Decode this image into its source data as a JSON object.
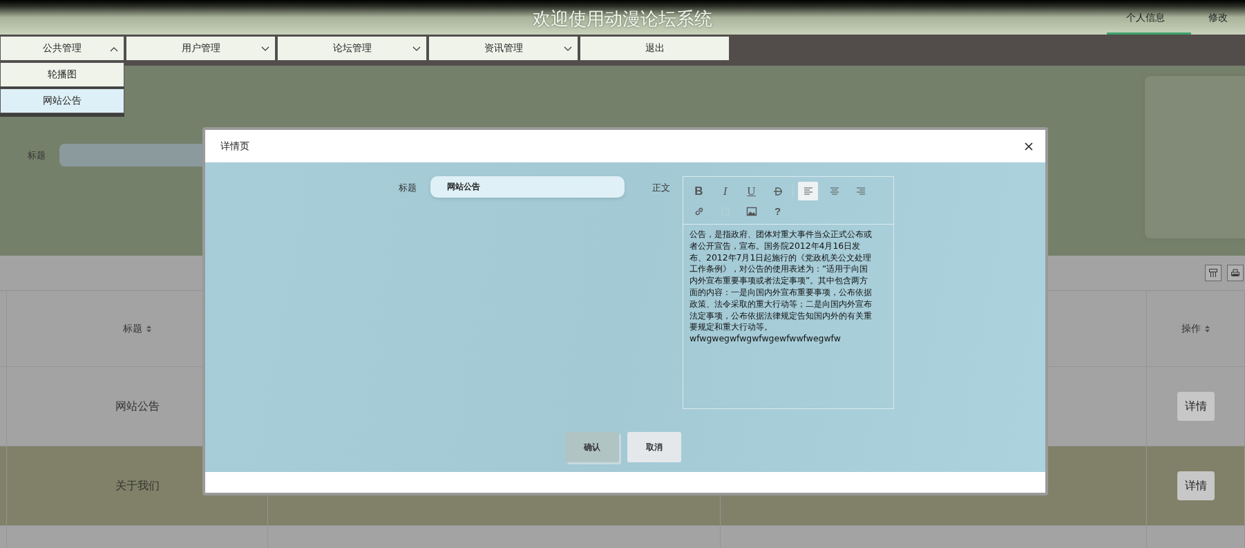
{
  "header": {
    "title": "欢迎使用动漫论坛系统",
    "user_links": [
      {
        "label": "个人信息",
        "selected": true
      },
      {
        "label": "修改",
        "selected": false
      }
    ]
  },
  "nav": [
    {
      "label": "公共管理",
      "kind": "dropdown",
      "expanded": true
    },
    {
      "label": "用户管理",
      "kind": "dropdown",
      "expanded": false
    },
    {
      "label": "论坛管理",
      "kind": "dropdown",
      "expanded": false
    },
    {
      "label": "资讯管理",
      "kind": "dropdown",
      "expanded": false
    },
    {
      "label": "退出",
      "kind": "link"
    }
  ],
  "dropdown": [
    {
      "label": "轮播图",
      "selected": false
    },
    {
      "label": "网站公告",
      "selected": true
    }
  ],
  "search": {
    "label": "标题"
  },
  "table": {
    "columns": [
      {
        "label": "标题"
      },
      {
        "label": "操作"
      }
    ],
    "rows": [
      {
        "title": "网站公告",
        "action": "详情",
        "highlighted": false
      },
      {
        "title": "关于我们",
        "action": "详情",
        "highlighted": true
      }
    ]
  },
  "modal": {
    "title": "详情页",
    "title_label": "标题",
    "title_value": "网站公告",
    "body_label": "正文",
    "toolbar": [
      {
        "kind": "bold",
        "label": "B",
        "selected": false,
        "disabled": false
      },
      {
        "kind": "italic",
        "label": "I",
        "selected": false,
        "disabled": false
      },
      {
        "kind": "underline",
        "label": "U",
        "selected": false,
        "disabled": false
      },
      {
        "kind": "strike",
        "selected": false,
        "disabled": false
      },
      {
        "kind": "align-left",
        "selected": true,
        "disabled": false
      },
      {
        "kind": "align-center",
        "selected": false,
        "disabled": false
      },
      {
        "kind": "align-right",
        "selected": false,
        "disabled": false
      },
      {
        "kind": "link",
        "selected": false,
        "disabled": false
      },
      {
        "kind": "table",
        "selected": false,
        "disabled": true
      },
      {
        "kind": "image",
        "selected": false,
        "disabled": false
      },
      {
        "kind": "help",
        "label": "?",
        "selected": false,
        "disabled": false
      }
    ],
    "body": [
      "公告，是指政府、团体对重大事件当众正式公布或者公开宣告，宣布。国务院2012年4月16日发布、2012年7月1日起施行的《党政机关公文处理工作条例》，对公告的使用表述为：“适用于向国内外宣布重要事项或者法定事项”。其中包含两方面的内容：一是向国内外宣布重要事项，公布依据政策、法令采取的重大行动等；二是向国内外宣布法定事项，公布依据法律规定告知国内外的有关重要规定和重大行动等。",
      "wfwgwegwfwgwfwgewfwwfwegwfw"
    ],
    "buttons": [
      {
        "label": "确认",
        "hovered": true
      },
      {
        "label": "取消",
        "hovered": false
      }
    ]
  }
}
